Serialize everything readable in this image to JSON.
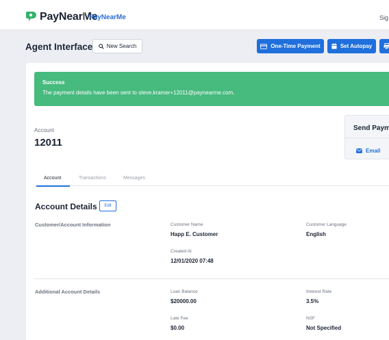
{
  "header": {
    "brand": "PayNearMe",
    "brand_sub": "PayNearMe",
    "signin": "Sig"
  },
  "toolbar": {
    "title": "Agent Interface",
    "new_search": "New Search",
    "one_time_payment": "One-Time Payment",
    "set_autopay": "Set Autopay"
  },
  "alert": {
    "title": "Success",
    "message": "The payment details have been sent to steve.kramer+12011@paynearme.com."
  },
  "account": {
    "label": "Account",
    "number": "12011"
  },
  "send_panel": {
    "title": "Send Paym",
    "email": "Email"
  },
  "tabs": [
    "Account",
    "Transactions",
    "Messages"
  ],
  "details": {
    "title": "Account Details",
    "edit": "Edit",
    "groups": [
      {
        "label": "Customer/Account Information",
        "fields": [
          {
            "label": "Customer Name",
            "value": "Happ E. Customer"
          },
          {
            "label": "Customer Language",
            "value": "English"
          },
          {
            "label": "Created At",
            "value": "12/01/2020 07:48"
          }
        ]
      },
      {
        "label": "Additional Account Details",
        "fields": [
          {
            "label": "Loan Balance",
            "value": "$20000.00"
          },
          {
            "label": "Interest Rate",
            "value": "3.5%"
          },
          {
            "label": "Late Fee",
            "value": "$0.00"
          },
          {
            "label": "NSF",
            "value": "Not Specified"
          }
        ]
      }
    ]
  },
  "colors": {
    "accent": "#1f6fdc",
    "success": "#47ba7e",
    "brand_green": "#2fb36b"
  }
}
